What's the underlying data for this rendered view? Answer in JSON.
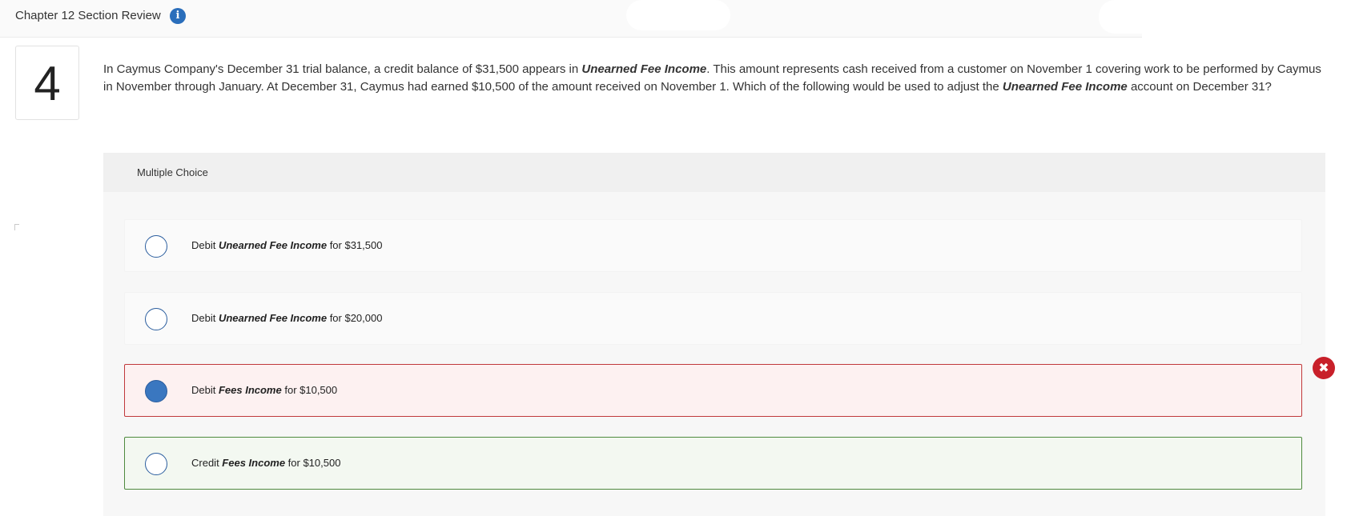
{
  "header": {
    "title": "Chapter 12 Section Review",
    "info_icon": "info-icon"
  },
  "question": {
    "number": "4",
    "segments": [
      "In Caymus Company's December 31 trial balance, a credit balance of $31,500 appears in ",
      "Unearned Fee Income",
      ". This amount represents cash received from a customer on November 1 covering work to be performed by Caymus in November through January. At December 31, Caymus had earned $10,500 of the amount received on November 1. Which of the following would be used to adjust the ",
      "Unearned Fee Income",
      " account on December 31?"
    ]
  },
  "multiple_choice": {
    "label": "Multiple Choice",
    "options": [
      {
        "prefix": "Debit ",
        "account": "Unearned Fee Income",
        "suffix": " for $31,500",
        "state": "default",
        "selected": false
      },
      {
        "prefix": "Debit ",
        "account": "Unearned Fee Income",
        "suffix": " for $20,000",
        "state": "default",
        "selected": false
      },
      {
        "prefix": "Debit ",
        "account": "Fees Income",
        "suffix": " for $10,500",
        "state": "incorrect",
        "selected": true
      },
      {
        "prefix": "Credit ",
        "account": "Fees Income",
        "suffix": " for $10,500",
        "state": "correct",
        "selected": false
      }
    ]
  },
  "colors": {
    "accent_blue": "#2a6ebb",
    "incorrect_red": "#c0393b",
    "correct_green": "#4e8a3e",
    "x_badge_red": "#c8202a"
  },
  "icons": {
    "incorrect_badge": "close-x-icon"
  }
}
